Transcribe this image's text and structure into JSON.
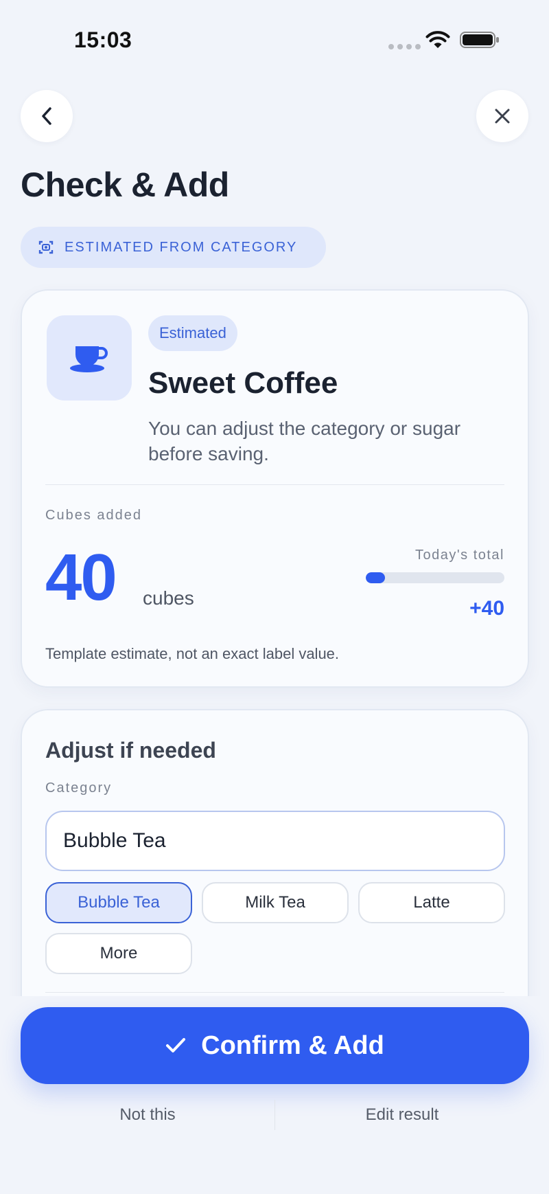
{
  "status_bar": {
    "time": "15:03"
  },
  "page": {
    "title": "Check & Add"
  },
  "source_pill": {
    "label": "ESTIMATED FROM CATEGORY",
    "icon": "camera-scan-icon"
  },
  "result": {
    "icon": "coffee-cup-icon",
    "badge": "Estimated",
    "name": "Sweet Coffee",
    "description": "You can adjust the category or sugar before saving.",
    "cubes_label": "Cubes added",
    "cubes_value": "40",
    "cubes_unit": "cubes",
    "today_label": "Today's total",
    "today_progress_fraction": 0.14,
    "today_delta": "+40",
    "footnote": "Template estimate, not an exact label value."
  },
  "adjust": {
    "title": "Adjust if needed",
    "category_label": "Category",
    "category_value": "Bubble Tea",
    "chips": [
      "Bubble Tea",
      "Milk Tea",
      "Latte",
      "More"
    ],
    "selected_chip": "Bubble Tea"
  },
  "actions": {
    "confirm_label": "Confirm & Add",
    "not_this_label": "Not this",
    "edit_label": "Edit result"
  },
  "colors": {
    "accent": "#2f5cf0",
    "accent_soft": "#e1e8fc",
    "background": "#f1f4fa"
  }
}
